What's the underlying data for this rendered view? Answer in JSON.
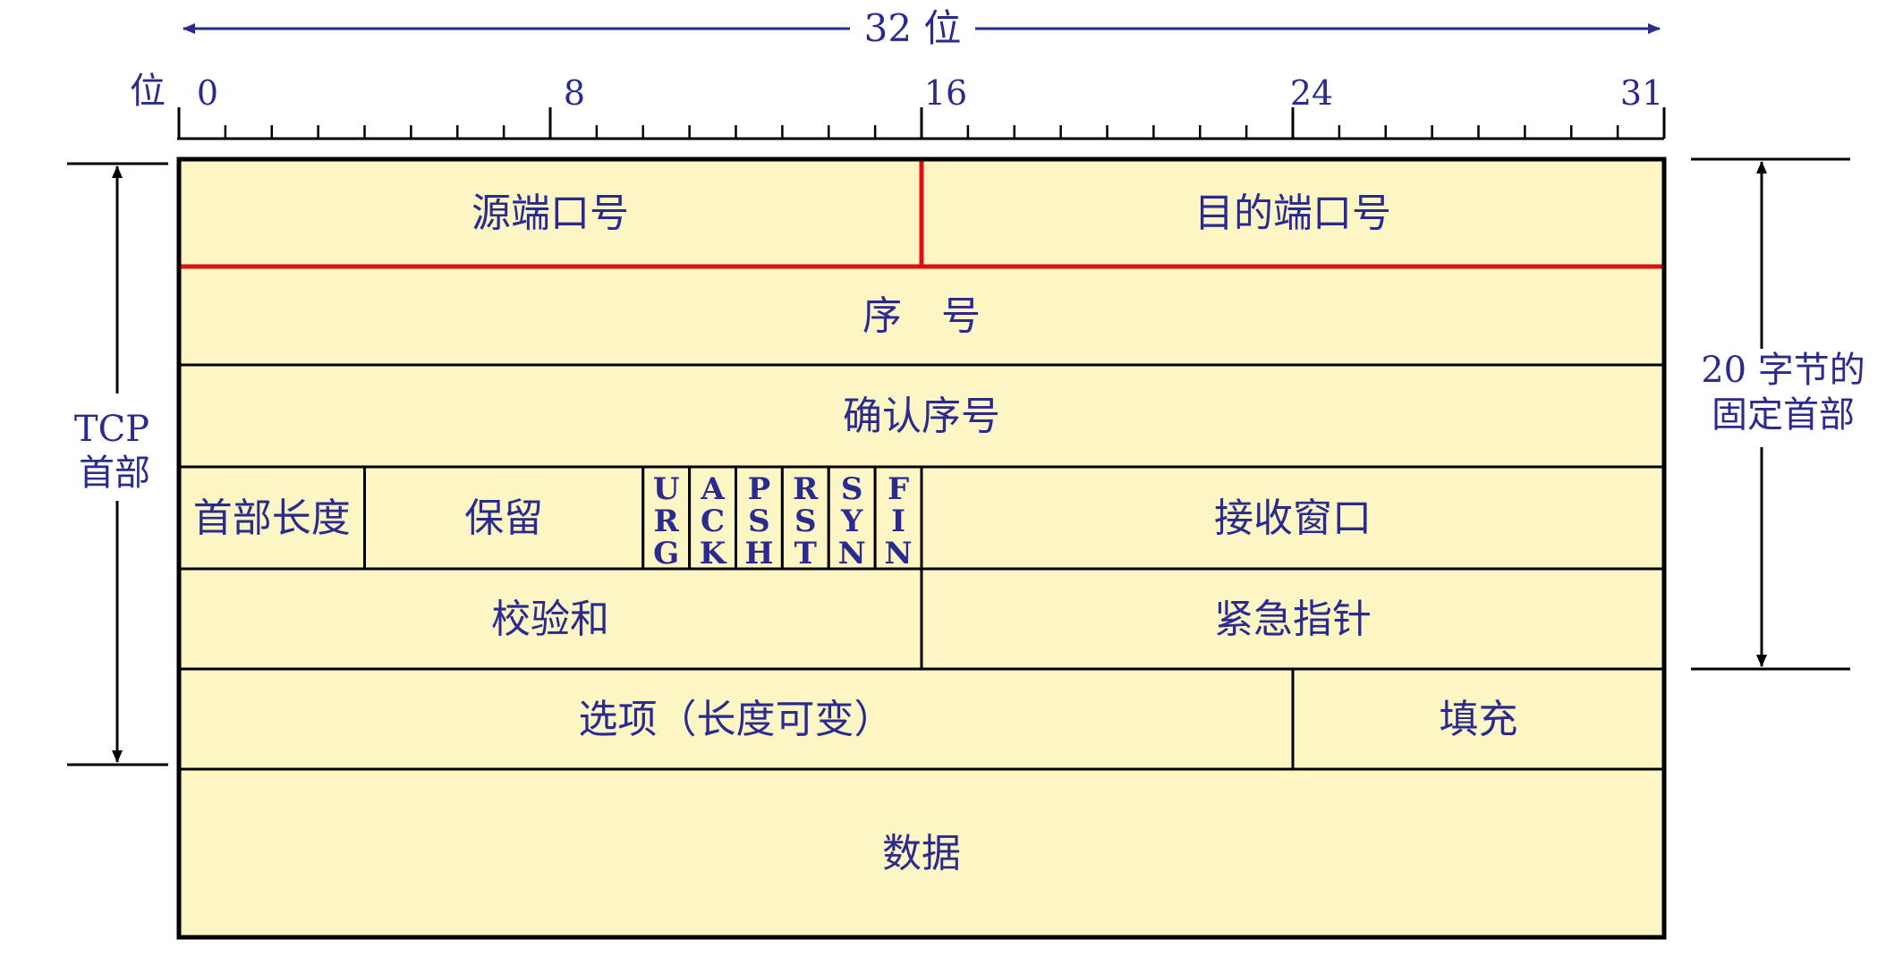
{
  "diagram": {
    "width_label": "32 位",
    "bit_axis_label": "位",
    "bit_ticks": [
      "0",
      "8",
      "16",
      "24",
      "31"
    ],
    "left_brace_label_lines": [
      "TCP",
      "首部"
    ],
    "right_brace_label_lines": [
      "20 字节的",
      "固定首部"
    ],
    "colors": {
      "cell_fill": "#fbf6c3",
      "label": "#2b2b8f",
      "highlight": "#e01010",
      "checksum_label": "#1020c0"
    },
    "rows": [
      {
        "fields": [
          {
            "label": "源端口号",
            "bits": 16,
            "highlight": true
          },
          {
            "label": "目的端口号",
            "bits": 16,
            "highlight": true
          }
        ]
      },
      {
        "fields": [
          {
            "label": "序　号",
            "bits": 32
          }
        ]
      },
      {
        "fields": [
          {
            "label": "确认序号",
            "bits": 32
          }
        ]
      },
      {
        "fields": [
          {
            "label": "首部长度",
            "bits": 4
          },
          {
            "label": "保留",
            "bits": 6
          },
          {
            "label": "URG",
            "bits": 1,
            "flag": true
          },
          {
            "label": "ACK",
            "bits": 1,
            "flag": true
          },
          {
            "label": "PSH",
            "bits": 1,
            "flag": true
          },
          {
            "label": "RST",
            "bits": 1,
            "flag": true
          },
          {
            "label": "SYN",
            "bits": 1,
            "flag": true
          },
          {
            "label": "FIN",
            "bits": 1,
            "flag": true
          },
          {
            "label": "接收窗口",
            "bits": 16
          }
        ]
      },
      {
        "fields": [
          {
            "label": "校验和",
            "bits": 16
          },
          {
            "label": "紧急指针",
            "bits": 16
          }
        ]
      },
      {
        "fields": [
          {
            "label": "选项（长度可变）",
            "bits": 24
          },
          {
            "label": "填充",
            "bits": 8
          }
        ]
      },
      {
        "fields": [
          {
            "label": "数据",
            "bits": 32
          }
        ]
      }
    ]
  }
}
